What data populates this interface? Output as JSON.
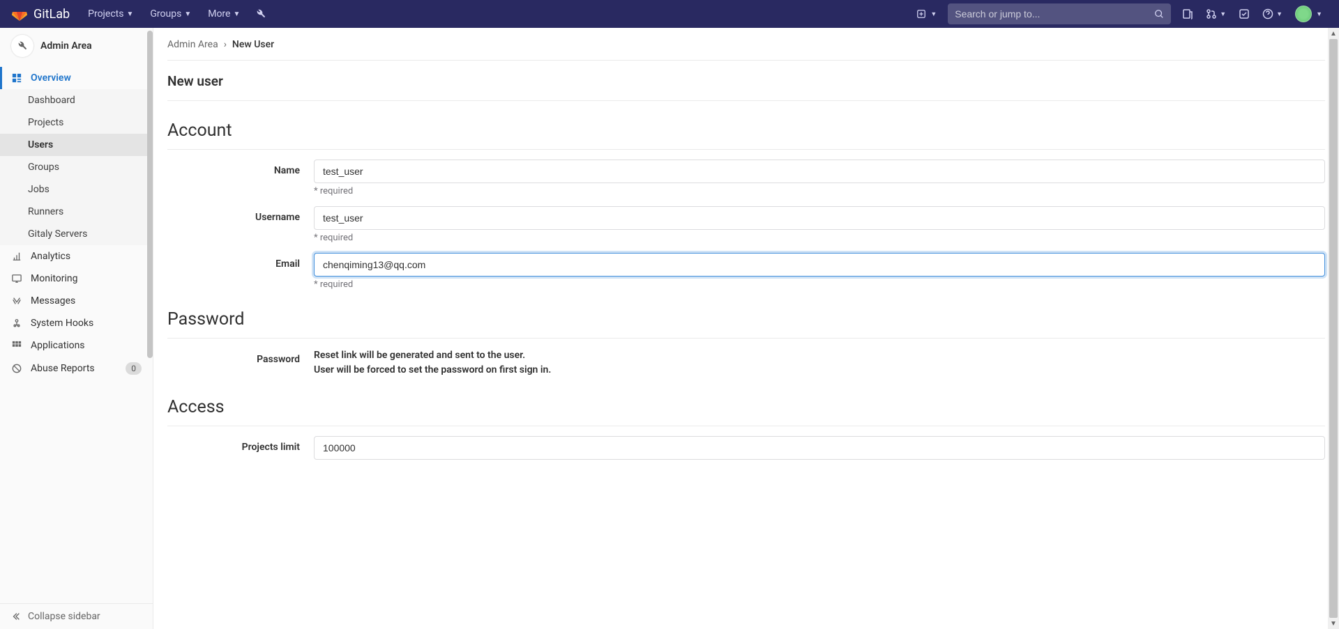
{
  "header": {
    "brand": "GitLab",
    "nav": {
      "projects": "Projects",
      "groups": "Groups",
      "more": "More"
    },
    "search_placeholder": "Search or jump to..."
  },
  "sidebar": {
    "title": "Admin Area",
    "overview": {
      "label": "Overview",
      "items": {
        "dashboard": "Dashboard",
        "projects": "Projects",
        "users": "Users",
        "groups": "Groups",
        "jobs": "Jobs",
        "runners": "Runners",
        "gitaly": "Gitaly Servers"
      }
    },
    "analytics": "Analytics",
    "monitoring": "Monitoring",
    "messages": "Messages",
    "system_hooks": "System Hooks",
    "applications": "Applications",
    "abuse_reports": {
      "label": "Abuse Reports",
      "count": "0"
    },
    "collapse": "Collapse sidebar"
  },
  "breadcrumb": {
    "root": "Admin Area",
    "current": "New User"
  },
  "page": {
    "title": "New user"
  },
  "sections": {
    "account": {
      "title": "Account",
      "name_label": "Name",
      "username_label": "Username",
      "email_label": "Email",
      "required": "* required"
    },
    "password": {
      "title": "Password",
      "label": "Password",
      "line1": "Reset link will be generated and sent to the user.",
      "line2": "User will be forced to set the password on first sign in."
    },
    "access": {
      "title": "Access",
      "projects_limit_label": "Projects limit"
    }
  },
  "form": {
    "name": "test_user",
    "username": "test_user",
    "email": "chenqiming13@qq.com",
    "projects_limit": "100000"
  }
}
